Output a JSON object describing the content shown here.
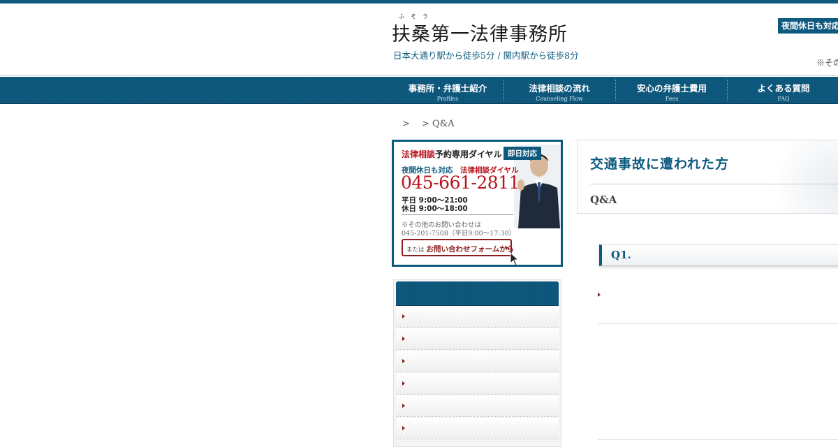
{
  "header": {
    "logo_ruby": "ふそう",
    "logo": "扶桑第一法律事務所",
    "access": "日本大通り駅から徒歩5分 / 関内駅から徒歩8分",
    "badge": "夜間休日も対応",
    "note": "※その"
  },
  "nav": {
    "items": [
      {
        "label": "事務所・弁護士紹介",
        "sub": "Profiles"
      },
      {
        "label": "法律相談の流れ",
        "sub": "Counseling Flow"
      },
      {
        "label": "安心の弁護士費用",
        "sub": "Fees"
      },
      {
        "label": "よくある質問",
        "sub": "FAQ"
      }
    ]
  },
  "breadcrumb": {
    "text": ">　 > Q&A"
  },
  "banner": {
    "title_highlight": "法律相談",
    "title_rest": "予約専用ダイヤル",
    "tag": "即日対応",
    "sub_left": "夜間休日も対応",
    "sub_right": "法律相談ダイヤル",
    "phone": "045-661-2811",
    "hours_weekday": "平日 9:00〜21:00",
    "hours_holiday": "休日 9:00〜18:00",
    "other_line1": "※その他のお問い合わせは",
    "other_line2": "045-201-7508（平日9:00〜17:30）",
    "form_small": "または",
    "form_big": "お問い合わせフォームから"
  },
  "main": {
    "title": "交通事故に遭われた方",
    "subtitle": "Q&A",
    "question_label": "Q1."
  },
  "colors": {
    "brand_blue": "#0e5a7f",
    "accent_red": "#b8121b"
  }
}
